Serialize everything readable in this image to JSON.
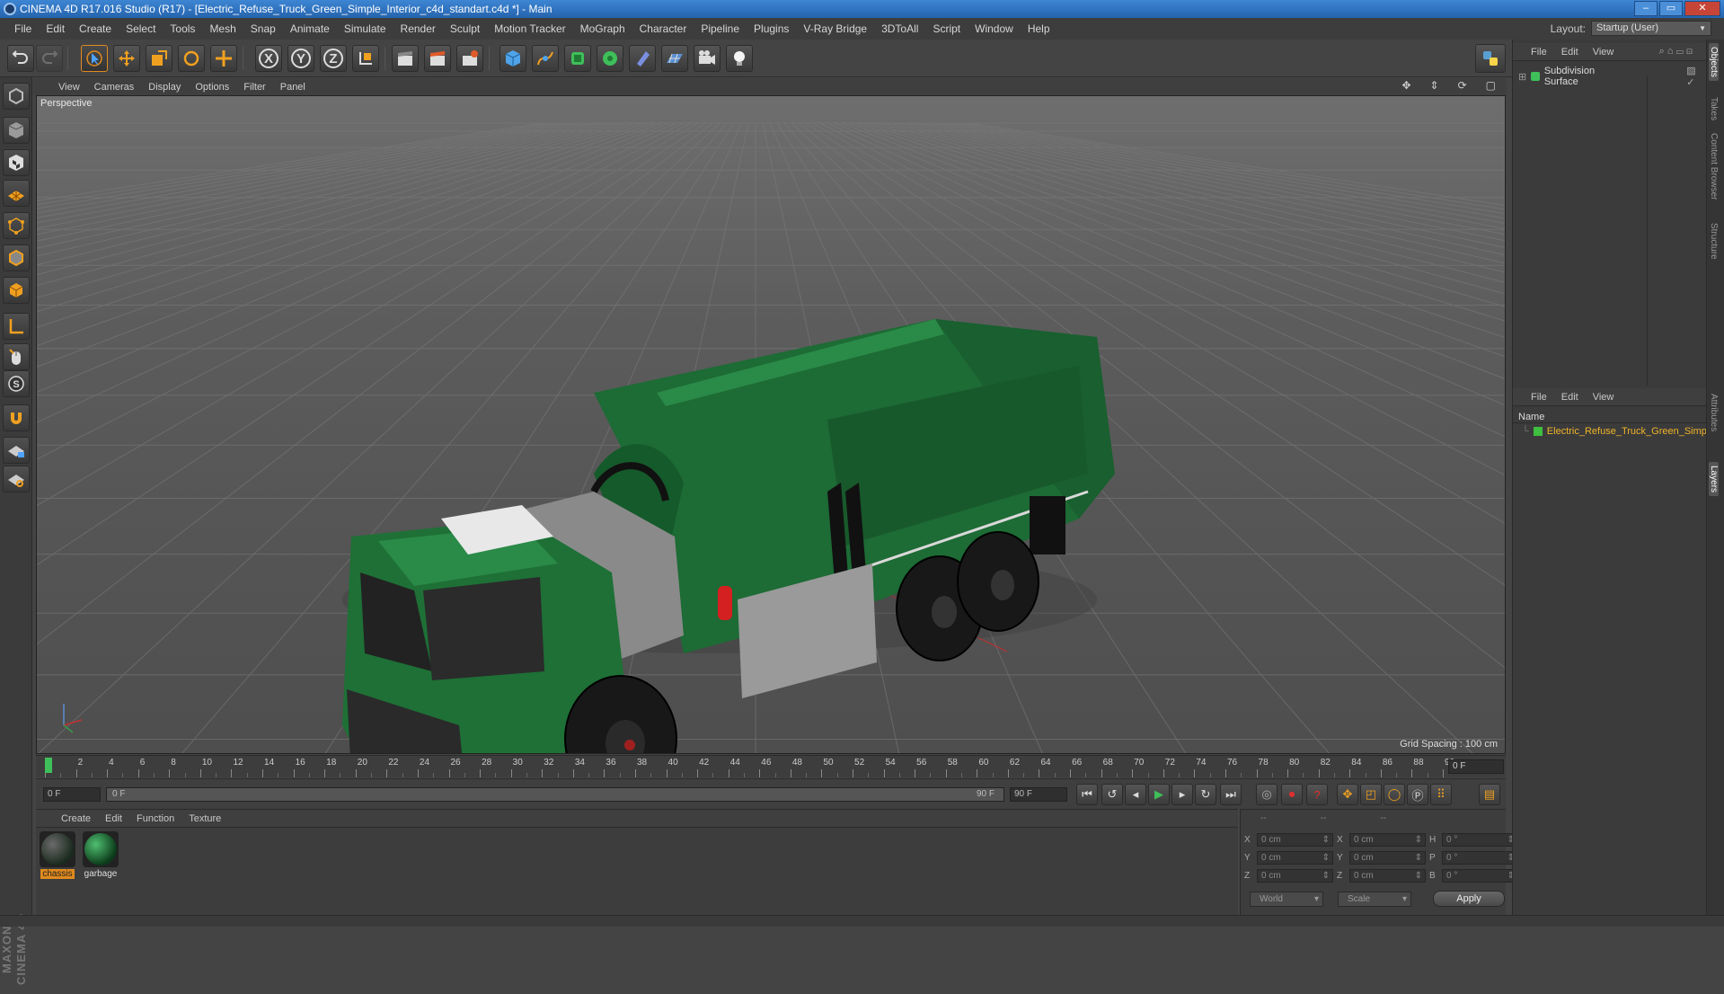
{
  "window": {
    "title": "CINEMA 4D R17.016 Studio (R17) - [Electric_Refuse_Truck_Green_Simple_Interior_c4d_standart.c4d *] - Main",
    "buttons": [
      "–",
      "▭",
      "✕"
    ]
  },
  "menubar": {
    "items": [
      "File",
      "Edit",
      "Create",
      "Select",
      "Tools",
      "Mesh",
      "Snap",
      "Animate",
      "Simulate",
      "Render",
      "Sculpt",
      "Motion Tracker",
      "MoGraph",
      "Character",
      "Pipeline",
      "Plugins",
      "V-Ray Bridge",
      "3DToAll",
      "Script",
      "Window",
      "Help"
    ],
    "layout_label": "Layout:",
    "layout_value": "Startup (User)"
  },
  "toolbar": {
    "axis_x": "X",
    "axis_y": "Y",
    "axis_z": "Z"
  },
  "viewport": {
    "menu": [
      "View",
      "Cameras",
      "Display",
      "Options",
      "Filter",
      "Panel"
    ],
    "label": "Perspective",
    "grid_spacing": "Grid Spacing : 100 cm",
    "axis_labels": {
      "y": "y",
      "x": "x",
      "z": "z"
    }
  },
  "timeline": {
    "ticks": [
      "0",
      "2",
      "4",
      "6",
      "8",
      "10",
      "12",
      "14",
      "16",
      "18",
      "20",
      "22",
      "24",
      "26",
      "28",
      "30",
      "32",
      "34",
      "36",
      "38",
      "40",
      "42",
      "44",
      "46",
      "48",
      "50",
      "52",
      "54",
      "56",
      "58",
      "60",
      "62",
      "64",
      "66",
      "68",
      "70",
      "72",
      "74",
      "76",
      "78",
      "80",
      "82",
      "84",
      "86",
      "88",
      "90"
    ],
    "current_frame": "0 F",
    "playhead": 0,
    "end": 90
  },
  "transport": {
    "start_field": "0 F",
    "range_start": "0 F",
    "range_end": "90 F",
    "end_field": "90 F"
  },
  "materials": {
    "menu": [
      "Create",
      "Edit",
      "Function",
      "Texture"
    ],
    "items": [
      {
        "label": "chassis",
        "selected": true
      },
      {
        "label": "garbage",
        "selected": false
      }
    ]
  },
  "coordinates": {
    "header": [
      "--",
      "--",
      "--"
    ],
    "rows": [
      {
        "a": "X",
        "av": "0 cm",
        "b": "X",
        "bv": "0 cm",
        "c": "H",
        "cv": "0 °"
      },
      {
        "a": "Y",
        "av": "0 cm",
        "b": "Y",
        "bv": "0 cm",
        "c": "P",
        "cv": "0 °"
      },
      {
        "a": "Z",
        "av": "0 cm",
        "b": "Z",
        "bv": "0 cm",
        "c": "B",
        "cv": "0 °"
      }
    ],
    "mode1": "World",
    "mode2": "Scale",
    "apply": "Apply"
  },
  "objects_panel": {
    "menu": [
      "File",
      "Edit",
      "View"
    ],
    "object": "Subdivision Surface"
  },
  "layers_panel": {
    "menu": [
      "File",
      "Edit",
      "View"
    ],
    "column": "Name",
    "layer": "Electric_Refuse_Truck_Green_Simp"
  },
  "side_tabs": [
    "Objects",
    "Takes",
    "Content Browser",
    "Structure",
    "Attributes",
    "Layers"
  ],
  "colors": {
    "accent": "#e08a1e",
    "title_blue": "#2f74c4",
    "truck_green": "#1d6b35",
    "layer_green": "#3fbf3f",
    "layer_text": "#f0b429"
  }
}
